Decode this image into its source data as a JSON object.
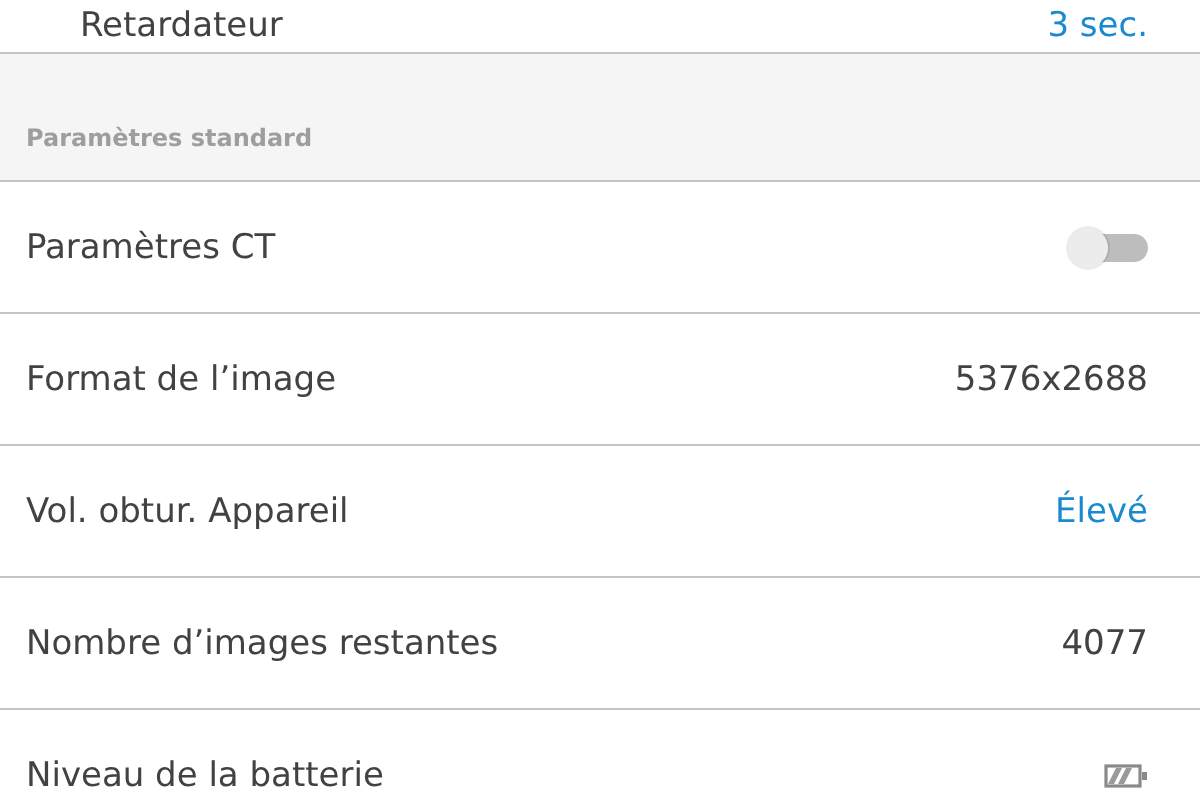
{
  "top_row": {
    "label": "Retardateur",
    "value": "3 sec."
  },
  "section": {
    "title": "Paramètres standard"
  },
  "rows": [
    {
      "kind": "toggle",
      "label": "Paramètres CT",
      "on": false
    },
    {
      "kind": "value",
      "label": "Format de l’image",
      "value": "5376x2688"
    },
    {
      "kind": "link",
      "label": "Vol. obtur. Appareil",
      "value": "Élevé"
    },
    {
      "kind": "value",
      "label": "Nombre d’images restantes",
      "value": "4077"
    },
    {
      "kind": "battery",
      "label": "Niveau de la batterie"
    }
  ]
}
